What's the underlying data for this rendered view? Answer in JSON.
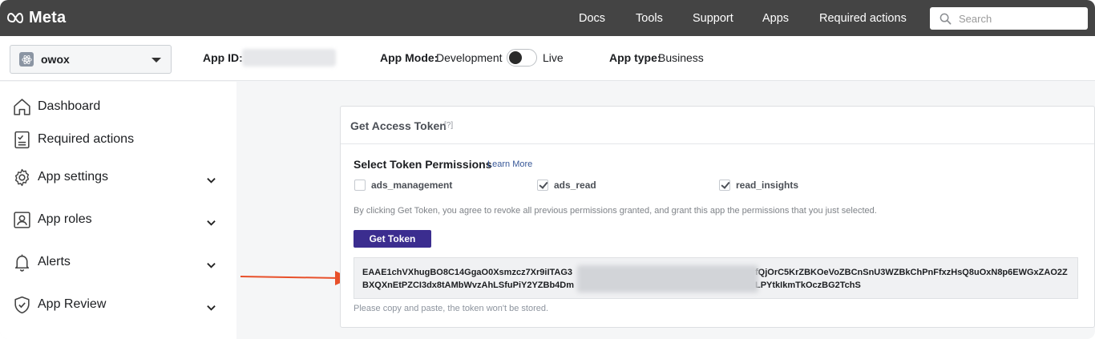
{
  "topbar": {
    "brand": "Meta",
    "nav": [
      "Docs",
      "Tools",
      "Support",
      "Apps",
      "Required actions"
    ],
    "search_placeholder": "Search"
  },
  "appbar": {
    "app_name": "owox",
    "app_id_label": "App ID:",
    "app_mode_label": "App Mode:",
    "app_mode_value": "Development",
    "live_label": "Live",
    "app_type_label": "App type:",
    "app_type_value": "Business"
  },
  "sidebar": {
    "items": [
      {
        "label": "Dashboard",
        "icon": "home-icon",
        "expandable": false
      },
      {
        "label": "Required actions",
        "icon": "checklist-icon",
        "expandable": false
      },
      {
        "label": "App settings",
        "icon": "gear-icon",
        "expandable": true
      },
      {
        "label": "App roles",
        "icon": "user-id-icon",
        "expandable": true
      },
      {
        "label": "Alerts",
        "icon": "bell-icon",
        "expandable": true
      },
      {
        "label": "App Review",
        "icon": "shield-check-icon",
        "expandable": true
      }
    ]
  },
  "card": {
    "title": "Get Access Token",
    "help": "[?]",
    "permissions_title": "Select Token Permissions",
    "learn_more": "Learn More",
    "permissions": [
      {
        "label": "ads_management",
        "checked": false
      },
      {
        "label": "ads_read",
        "checked": true
      },
      {
        "label": "read_insights",
        "checked": true
      }
    ],
    "consent_text": "By clicking Get Token, you agree to revoke all previous permissions granted, and grant this app the permissions that you just selected.",
    "get_token_label": "Get Token",
    "token": {
      "line1_start": "EAAE1chVXhugBO8C14GgaO0Xsmzcz7Xr9iITAG3",
      "line1_end": "fQjOrC5KrZBKOeVoZBCnSnU3WZBkChPnFfxzHsQ8uOxN8p6EWGxZAO2Z",
      "line2_start": "BXQXnEtPZCI3dx8tAMbWvzAhLSfuPiY2YZBb4Dm",
      "line2_end": "LPYtkIkmTkOczBG2TchS"
    },
    "copy_note": "Please copy and paste, the token won't be stored."
  },
  "colors": {
    "topbar_bg": "#444444",
    "button_bg": "#3b2d8f",
    "arrow": "#e8502a",
    "link": "#385898"
  }
}
